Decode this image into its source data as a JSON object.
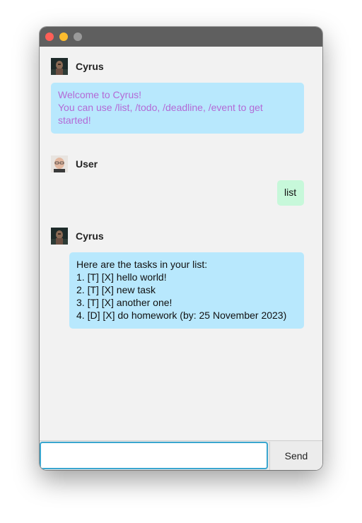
{
  "window": {
    "controls": [
      "close",
      "minimize",
      "maximize"
    ]
  },
  "messages": [
    {
      "sender": "Cyrus",
      "text": "Welcome to Cyrus!\nYou can use /list, /todo, /deadline, /event to get started!"
    },
    {
      "sender": "User",
      "text": "list"
    },
    {
      "sender": "Cyrus",
      "text": "Here are the tasks in your list:\n1. [T] [X] hello world!\n2. [T] [X] new task\n3. [T] [X] another one!\n4. [D] [X] do homework (by: 25 November 2023)"
    }
  ],
  "input": {
    "value": "",
    "placeholder": ""
  },
  "send_label": "Send",
  "colors": {
    "bot_bubble": "#b8e8fd",
    "user_bubble": "#c7f8da",
    "welcome_text": "#b36ad6",
    "input_border": "#3aa6cf"
  }
}
